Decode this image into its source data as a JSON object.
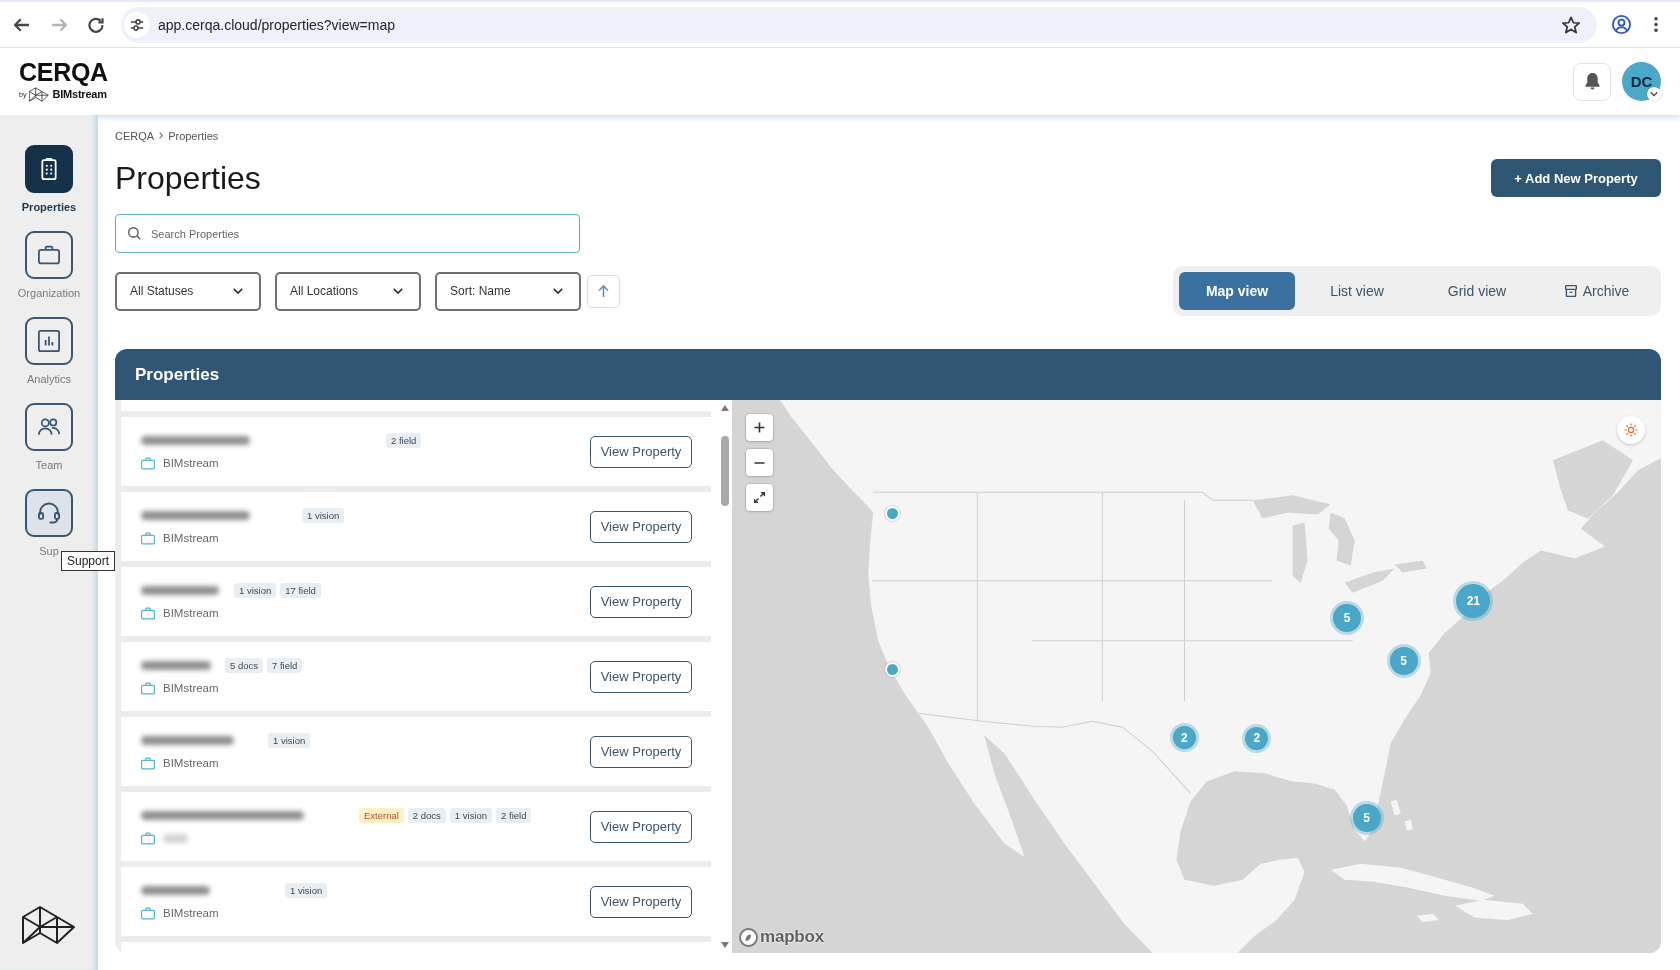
{
  "browser": {
    "nav": [
      {
        "kind": "back",
        "disabled": false
      },
      {
        "kind": "forward",
        "disabled": true
      },
      {
        "kind": "reload",
        "disabled": false
      }
    ],
    "url": "app.cerqa.cloud/properties?view=map"
  },
  "header": {
    "brand": "CERQA",
    "byline": "by",
    "partner": "BIMstream",
    "avatar": "DC"
  },
  "sidebar": {
    "items": [
      {
        "kind": "building",
        "label": "Properties",
        "selected": true,
        "hovered": false
      },
      {
        "kind": "briefcase",
        "label": "Organization",
        "selected": false,
        "hovered": false
      },
      {
        "kind": "chart",
        "label": "Analytics",
        "selected": false,
        "hovered": false
      },
      {
        "kind": "people",
        "label": "Team",
        "selected": false,
        "hovered": false
      },
      {
        "kind": "headset",
        "label": "Sup",
        "selected": false,
        "hovered": true
      }
    ],
    "tooltip": "Support"
  },
  "breadcrumb": [
    "CERQA",
    "Properties"
  ],
  "title": "Properties",
  "add_button": "+ Add New Property",
  "search": {
    "placeholder": "Search Properties"
  },
  "filters": {
    "dropdowns": [
      "All Statuses",
      "All Locations",
      "Sort: Name"
    ],
    "sort_ascending": true
  },
  "views": [
    {
      "kind": "view",
      "label": "Map view",
      "selected": true
    },
    {
      "kind": "view",
      "label": "List view",
      "selected": false
    },
    {
      "kind": "view",
      "label": "Grid view",
      "selected": false
    },
    {
      "kind": "archive",
      "label": "Archive",
      "selected": false
    }
  ],
  "panel": {
    "title": "Properties",
    "properties": [
      {
        "tags": [
          {
            "kind": "count",
            "label": "2 field"
          }
        ],
        "org": "BIMstream",
        "action": "View Property"
      },
      {
        "tags": [
          {
            "kind": "count",
            "label": "1 vision"
          }
        ],
        "org": "BIMstream",
        "action": "View Property"
      },
      {
        "tags": [
          {
            "kind": "count",
            "label": "1 vision"
          },
          {
            "kind": "count",
            "label": "17 field"
          }
        ],
        "org": "BIMstream",
        "action": "View Property"
      },
      {
        "tags": [
          {
            "kind": "count",
            "label": "5 docs"
          },
          {
            "kind": "count",
            "label": "7 field"
          }
        ],
        "org": "BIMstream",
        "action": "View Property"
      },
      {
        "tags": [
          {
            "kind": "count",
            "label": "1 vision"
          }
        ],
        "org": "BIMstream",
        "action": "View Property"
      },
      {
        "tags": [
          {
            "kind": "external",
            "label": "External"
          },
          {
            "kind": "count",
            "label": "2 docs"
          },
          {
            "kind": "count",
            "label": "1 vision"
          },
          {
            "kind": "count",
            "label": "2 field"
          }
        ],
        "action": "View Property"
      },
      {
        "tags": [
          {
            "kind": "count",
            "label": "1 vision"
          }
        ],
        "org": "BIMstream",
        "action": "View Property"
      }
    ],
    "map": {
      "markers": [
        {
          "kind": "point"
        },
        {
          "kind": "cluster",
          "count": "21"
        },
        {
          "kind": "cluster",
          "count": "5"
        },
        {
          "kind": "cluster",
          "count": "5"
        },
        {
          "kind": "point"
        },
        {
          "kind": "cluster",
          "count": "2"
        },
        {
          "kind": "cluster",
          "count": "2"
        },
        {
          "kind": "cluster",
          "count": "5"
        }
      ],
      "attribution": "mapbox"
    }
  }
}
